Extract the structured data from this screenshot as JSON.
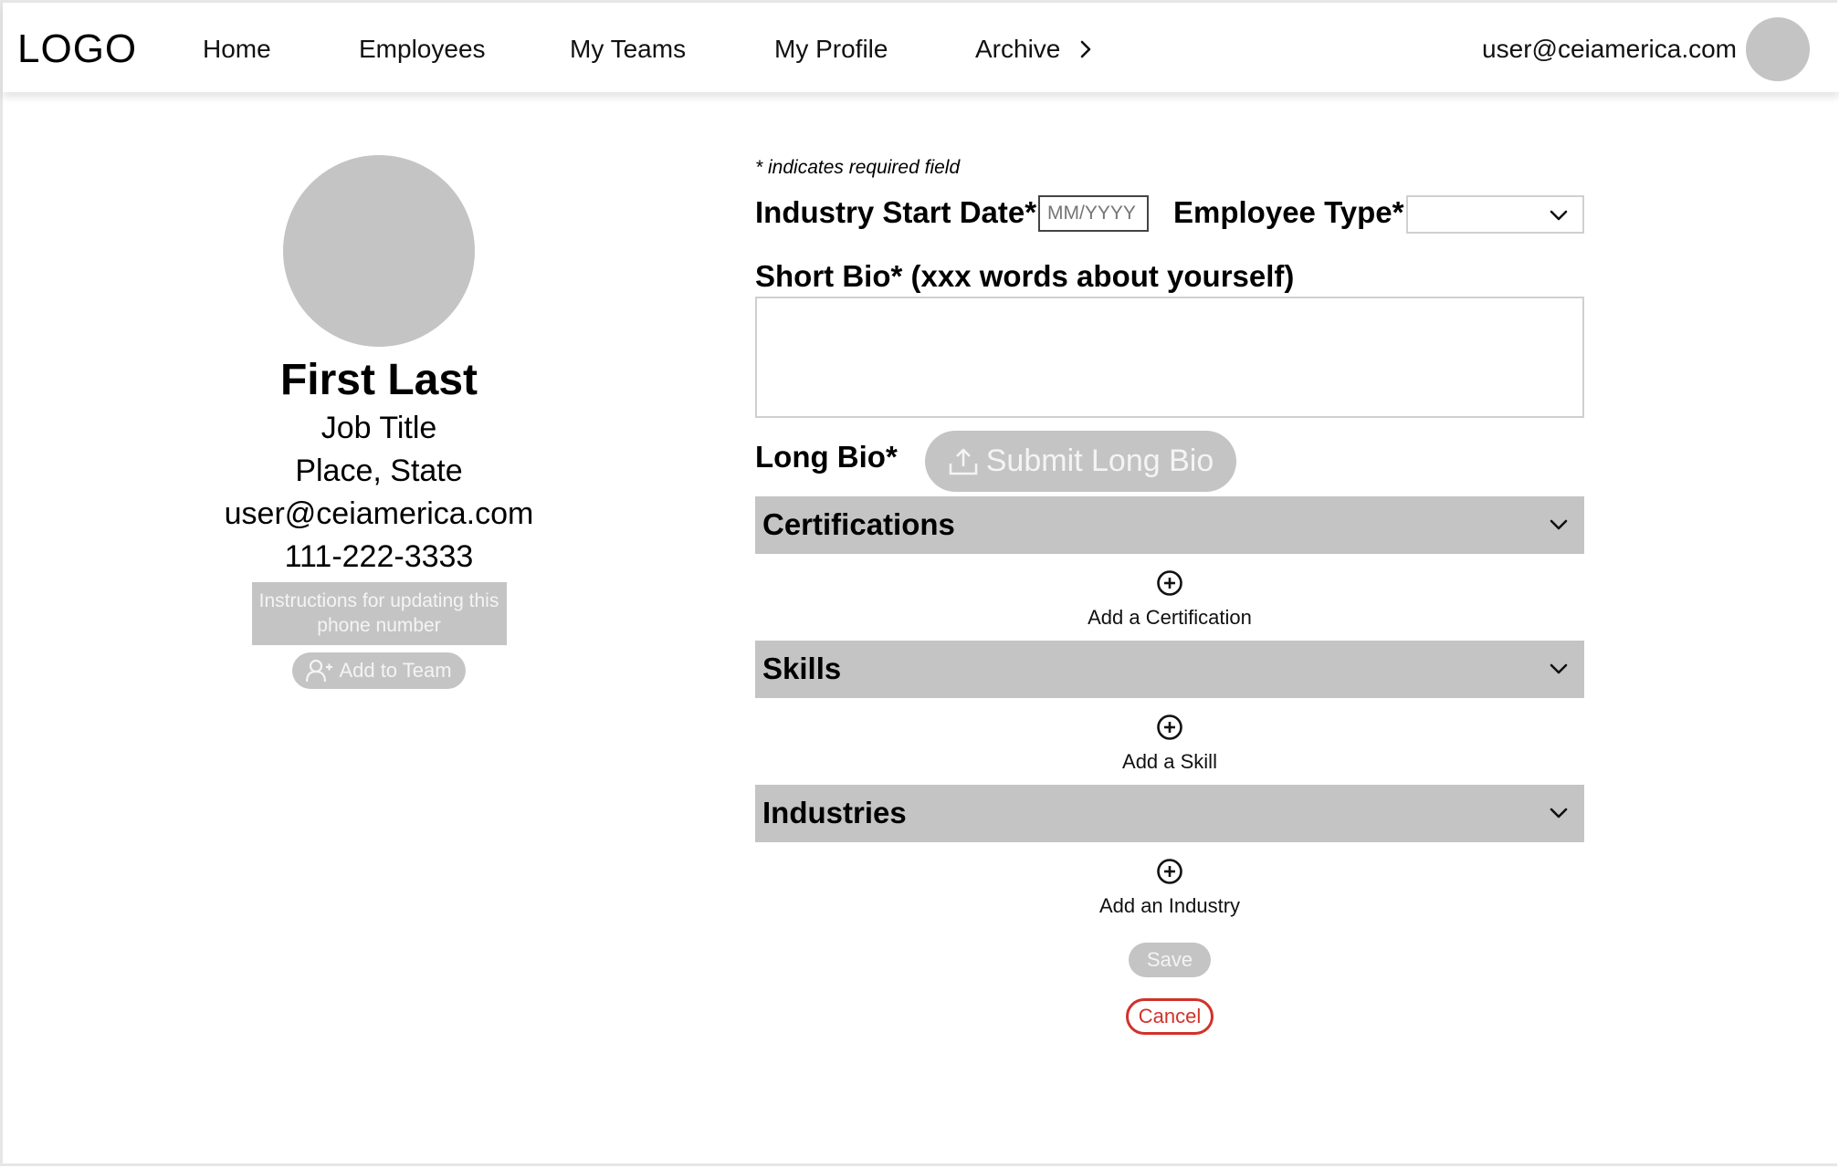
{
  "nav": {
    "logo": "LOGO",
    "items": [
      {
        "label": "Home"
      },
      {
        "label": "Employees"
      },
      {
        "label": "My Teams"
      },
      {
        "label": "My Profile"
      },
      {
        "label": "Archive"
      }
    ],
    "archive_icon": "chevron-right-icon",
    "user_email": "user@ceiamerica.com",
    "avatar_icon": "user-avatar"
  },
  "profile": {
    "name": "First Last",
    "job_title": "Job Title",
    "location": "Place, State",
    "email": "user@ceiamerica.com",
    "phone": "111-222-3333",
    "instructions": "Instructions for updating this phone number",
    "add_to_team_label": "Add to Team",
    "add_to_team_icon": "user-plus-icon"
  },
  "form": {
    "required_note": "* indicates required field",
    "industry_start_date": {
      "label": "Industry Start Date*",
      "placeholder": "MM/YYYY",
      "value": ""
    },
    "employee_type": {
      "label": "Employee Type*",
      "selected": ""
    },
    "short_bio": {
      "label": "Short Bio* (xxx words about yourself)",
      "value": ""
    },
    "long_bio": {
      "label": "Long Bio*",
      "submit_label": "Submit Long Bio",
      "submit_icon": "upload-icon"
    },
    "sections": [
      {
        "title": "Certifications",
        "add_label": "Add a Certification"
      },
      {
        "title": "Skills",
        "add_label": "Add a Skill"
      },
      {
        "title": "Industries",
        "add_label": "Add an Industry"
      }
    ],
    "save_label": "Save",
    "cancel_label": "Cancel"
  },
  "colors": {
    "placeholder_gray": "#c4c4c4",
    "cancel_red": "#d1322a"
  }
}
